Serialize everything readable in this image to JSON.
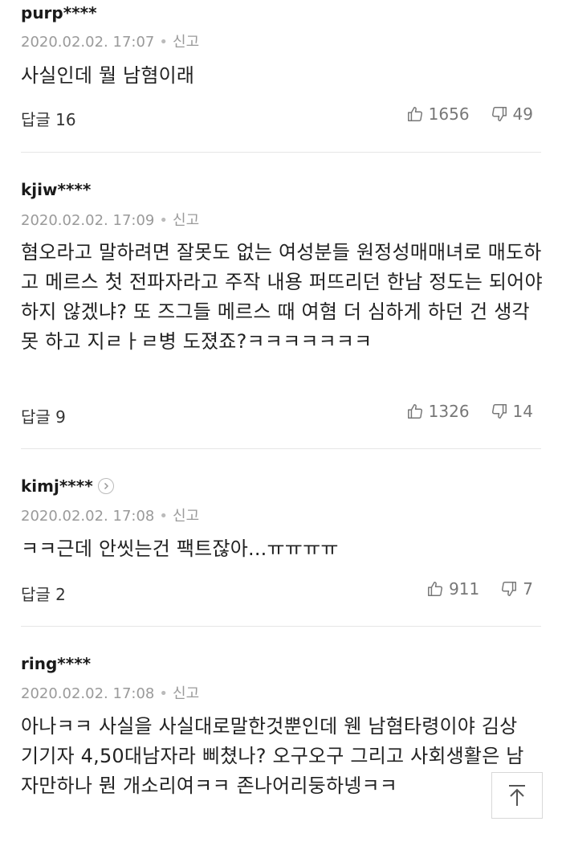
{
  "comments": [
    {
      "user": "purp****",
      "date": "2020.02.02. 17:07",
      "report": "신고",
      "text": "사실인데 뭘 남혐이래",
      "reply_label": "답글 16",
      "likes": "1656",
      "dislikes": "49"
    },
    {
      "user": "kjiw****",
      "date": "2020.02.02. 17:09",
      "report": "신고",
      "text": "혐오라고 말하려면 잘못도 없는 여성분들 원정성매매녀로 매도하고 메르스 첫 전파자라고 주작 내용 퍼뜨리던 한남 정도는 되어야 하지 않겠냐? 또 즈그들 메르스 때 여혐 더 심하게 하던 건 생각 못 하고 지ㄹㅏㄹ병 도졌죠?ㅋㅋㅋㅋㅋㅋㅋ",
      "reply_label": "답글 9",
      "likes": "1326",
      "dislikes": "14"
    },
    {
      "user": "kimj****",
      "date": "2020.02.02. 17:08",
      "report": "신고",
      "text": "ㅋㅋ근데 안씻는건 팩트잖아...ㅠㅠㅠㅠ",
      "reply_label": "답글 2",
      "likes": "911",
      "dislikes": "7"
    },
    {
      "user": "ring****",
      "date": "2020.02.02. 17:08",
      "report": "신고",
      "text": "아나ㅋㅋ 사실을 사실대로말한것뿐인데 웬 남혐타령이야 김상기기자 4,50대남자라 삐쳤나? 오구오구 그리고 사회생활은 남자만하나 뭔 개소리여ㅋㅋ 존나어리둥하넹ㅋㅋ"
    }
  ],
  "icons": {
    "like": "thumbs-up-icon",
    "dislike": "thumbs-down-icon",
    "profile_arrow": "chevron-right-icon",
    "scroll_top": "arrow-up-icon"
  }
}
